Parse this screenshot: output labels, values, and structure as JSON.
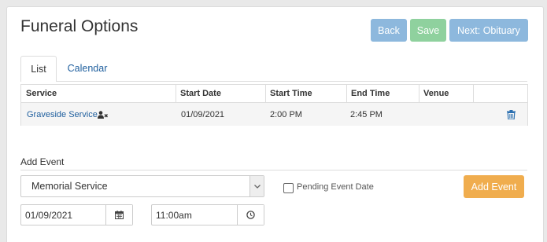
{
  "header": {
    "title": "Funeral Options",
    "back_label": "Back",
    "save_label": "Save",
    "next_label": "Next: Obituary"
  },
  "tabs": [
    {
      "label": "List",
      "active": true
    },
    {
      "label": "Calendar",
      "active": false
    }
  ],
  "table": {
    "columns": [
      "Service",
      "Start Date",
      "Start Time",
      "End Time",
      "Venue"
    ],
    "rows": [
      {
        "service": "Graveside Service",
        "start_date": "01/09/2021",
        "start_time": "2:00 PM",
        "end_time": "2:45 PM",
        "venue": ""
      }
    ]
  },
  "add_event": {
    "label": "Add Event",
    "event_type": "Memorial Service",
    "pending_label": "Pending Event Date",
    "pending_checked": false,
    "date_value": "01/09/2021",
    "time_value": "11:00am",
    "add_button_label": "Add Event"
  },
  "colors": {
    "primary_light": "#8db8dd",
    "success_light": "#8fd19e",
    "warning": "#f0ad4e",
    "link": "#1f5f9e"
  }
}
